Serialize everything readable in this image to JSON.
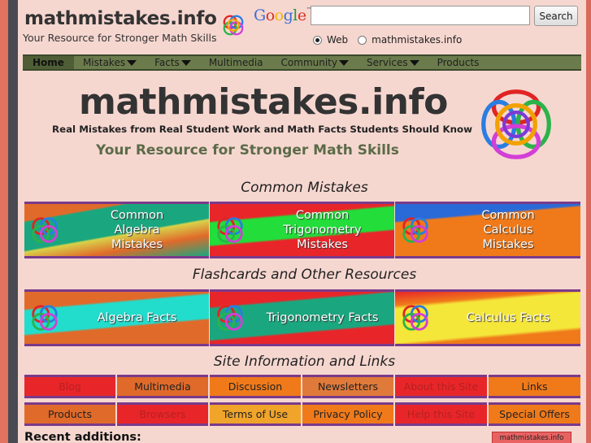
{
  "header": {
    "site_title": "mathmistakes.info",
    "tagline": "Your Resource for Stronger Math Skills"
  },
  "search": {
    "logo_text": "Google",
    "button_label": "Search",
    "radio_web": "Web",
    "radio_site": "mathmistakes.info"
  },
  "nav": {
    "items": [
      "Home",
      "Mistakes",
      "Facts",
      "Multimedia",
      "Community",
      "Services",
      "Products"
    ]
  },
  "banner": {
    "title": "mathmistakes.info",
    "subtitle": "Real Mistakes from Real Student Work and Math Facts Students Should Know",
    "tagline": "Your Resource for Stronger Math Skills"
  },
  "sections": {
    "common_mistakes": "Common Mistakes",
    "flashcards": "Flashcards and Other Resources",
    "site_info": "Site Information and Links"
  },
  "mistake_tiles": [
    {
      "line1": "Common",
      "line2": "Algebra",
      "line3": "Mistakes"
    },
    {
      "line1": "Common",
      "line2": "Trigonometry",
      "line3": "Mistakes"
    },
    {
      "line1": "Common",
      "line2": "Calculus",
      "line3": "Mistakes"
    }
  ],
  "fact_tiles": [
    "Algebra Facts",
    "Trigonometry Facts",
    "Calculus Facts"
  ],
  "links_row1": [
    "Blog",
    "Multimedia",
    "Discussion",
    "Newsletters",
    "About this Site",
    "Links"
  ],
  "links_row2": [
    "Products",
    "Browsers",
    "Terms of Use",
    "Privacy Policy",
    "Help this Site",
    "Special Offers"
  ],
  "recent": "Recent additions:",
  "store_badge": "mathmistakes.info store",
  "colors": {
    "page_bg": "#f6d7d0",
    "nav_bg": "#6b7b4c",
    "frame": "#d9695a",
    "tagline_green": "#5b6b48"
  }
}
